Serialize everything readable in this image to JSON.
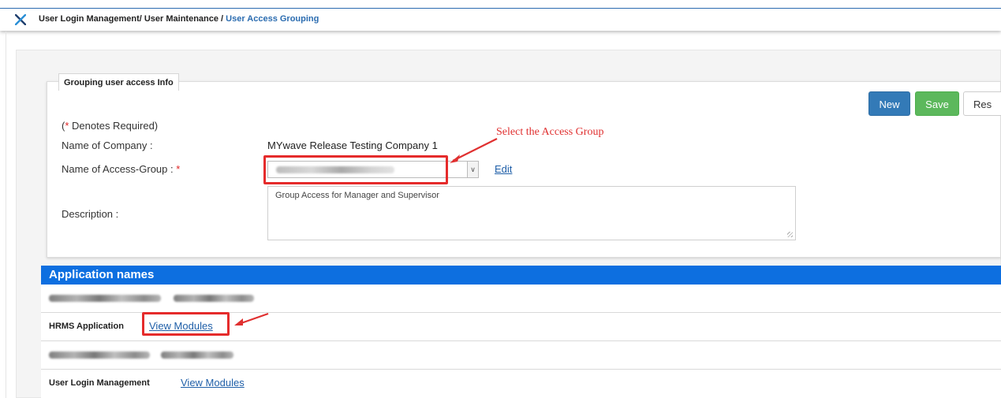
{
  "breadcrumb": {
    "part1": "User Login Management/",
    "part2": " User Maintenance /",
    "current": " User Access Grouping"
  },
  "form": {
    "legend": "Grouping user access Info",
    "buttons": {
      "new": "New",
      "save": "Save",
      "reset": "Res"
    },
    "required_note_open": "(",
    "required_star": "*",
    "required_note_text": " Denotes Required)",
    "company_label": "Name of Company :",
    "company_value": "MYwave Release Testing Company 1",
    "access_group_label": "Name of Access-Group : ",
    "access_group_star": "*",
    "edit_link": "Edit",
    "description_label": "Description :",
    "description_value": "Group Access for Manager and Supervisor"
  },
  "annotation": {
    "text": "Select the Access Group",
    "color": "#e03030"
  },
  "applications": {
    "header": "Application names",
    "rows": [
      {
        "name": "",
        "link": "",
        "blurred": true
      },
      {
        "name": "HRMS Application",
        "link": "View Modules",
        "blurred": false
      },
      {
        "name": "",
        "link": "",
        "blurred": true
      },
      {
        "name": "User Login Management",
        "link": "View Modules",
        "blurred": false
      }
    ]
  },
  "colors": {
    "primary": "#337ab7",
    "success": "#5cb85c",
    "header_blue": "#0d6fe0",
    "link": "#1f5fa8",
    "highlight": "#e52b2b"
  }
}
